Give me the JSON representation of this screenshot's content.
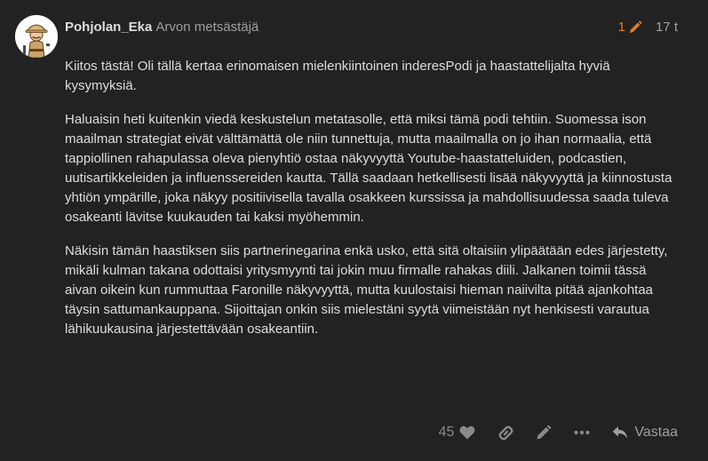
{
  "post": {
    "username": "Pohjolan_Eka",
    "user_title": "Arvon metsästäjä",
    "edit_count": "1",
    "date": "17 t",
    "paragraphs": [
      "Kiitos tästä! Oli tällä kertaa erinomaisen mielenkiintoinen inderesPodi ja haastattelijalta hyviä kysymyksiä.",
      "Haluaisin heti kuitenkin viedä keskustelun metatasolle, että miksi tämä podi tehtiin. Suomessa ison maailman strategiat eivät välttämättä ole niin tunnettuja, mutta maailmalla on jo ihan normaalia, että tappiollinen rahapulassa oleva pienyhtiö ostaa näkyvyyttä Youtube-haastatteluiden, podcastien, uutisartikkeleiden ja influenssereiden kautta. Tällä saadaan hetkellisesti lisää näkyvyyttä ja kiinnostusta yhtiön ympärille, joka näkyy positiivisella tavalla osakkeen kurssissa ja mahdollisuudessa saada tuleva osakeanti lävitse kuukauden tai kaksi myöhemmin.",
      "Näkisin tämän haastiksen siis partnerinegarina enkä usko, että sitä oltaisiin ylipäätään edes järjestetty, mikäli kulman takana odottaisi yritysmyynti tai jokin muu firmalle rahakas diili. Jalkanen toimii tässä aivan oikein kun rummuttaa Faronille näkyvyyttä, mutta kuulostaisi hieman naiivilta pitää ajankohtaa täysin sattumankauppana. Sijoittajan onkin siis mielestäni syytä viimeistään nyt henkisesti varautua lähikuukausina järjestettävään osakeantiin."
    ],
    "like_count": "45",
    "reply_label": "Vastaa"
  },
  "colors": {
    "background": "#222222",
    "text": "#dddddd",
    "muted": "#a0a0a0",
    "edit_accent": "#e07b24"
  },
  "icons": {
    "avatar": "explorer-avatar",
    "edit_history": "pencil-icon",
    "like": "heart-icon",
    "link": "link-icon",
    "edit": "pencil-icon",
    "more": "ellipsis-icon",
    "reply": "reply-arrow-icon"
  }
}
